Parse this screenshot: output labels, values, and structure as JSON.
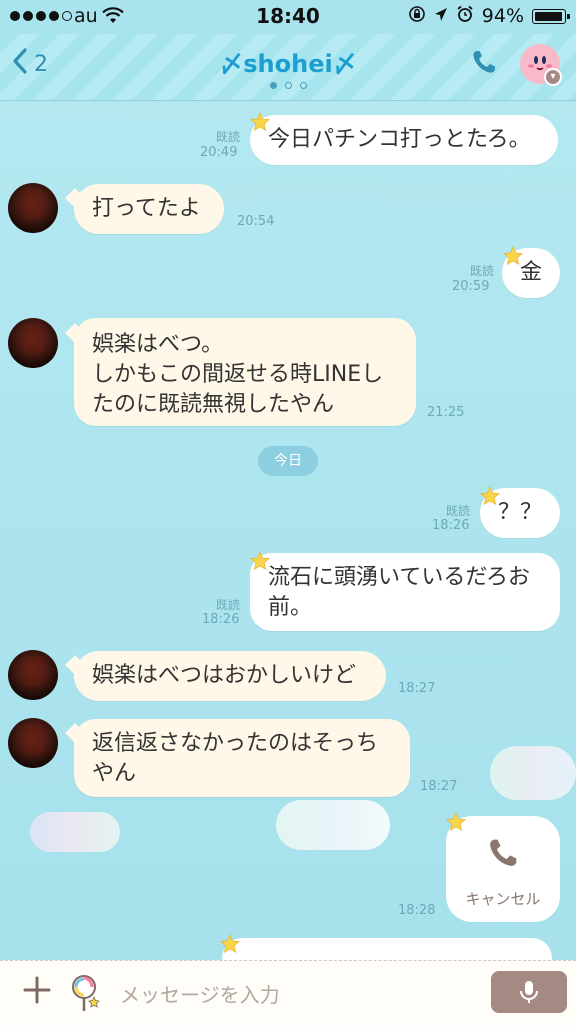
{
  "status_bar": {
    "carrier": "au",
    "time": "18:40",
    "battery": "94%",
    "battery_level": 0.94
  },
  "header": {
    "back_count": "2",
    "title": "〆shohei〆",
    "page_count": 3,
    "active_page": 0
  },
  "messages": [
    {
      "side": "out",
      "text": "今日パチンコ打っとたろ。",
      "read": "既読",
      "time": "20:49"
    },
    {
      "side": "in",
      "text": "打ってたよ",
      "time": "20:54"
    },
    {
      "side": "out",
      "text": "金",
      "read": "既読",
      "time": "20:59"
    },
    {
      "side": "in",
      "lines": [
        "娯楽はべつ。",
        "しかもこの間返せる時LINEし",
        "たのに既読無視したやん"
      ],
      "time": "21:25"
    },
    {
      "side": "out",
      "text": "？？",
      "read": "既読",
      "time": "18:26"
    },
    {
      "side": "out",
      "lines": [
        "流石に頭湧いているだろお",
        "前。"
      ],
      "read": "既読",
      "time": "18:26"
    },
    {
      "side": "in",
      "text": "娯楽はべつはおかしいけど",
      "time": "18:27"
    },
    {
      "side": "in",
      "lines": [
        "返信返さなかったのはそっち",
        "やん"
      ],
      "time": "18:27"
    },
    {
      "side": "out",
      "call_label": "キャンセル",
      "time": "18:28"
    }
  ],
  "date_separator": "今日",
  "input": {
    "placeholder": "メッセージを入力"
  },
  "colors": {
    "accent": "#1a9fd0",
    "incoming_bubble": "#fff8e8",
    "outgoing_bubble": "#ffffff",
    "background": "#a9e4ee",
    "input_button": "#a48a83"
  },
  "icons": [
    "back-chevron-icon",
    "phone-icon",
    "kirby-avatar-icon",
    "star-icon",
    "plus-icon",
    "candy-icon",
    "microphone-icon"
  ]
}
